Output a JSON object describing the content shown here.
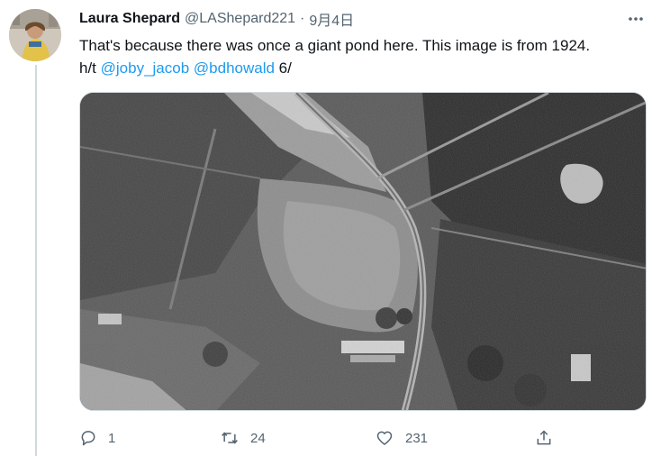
{
  "tweet": {
    "author": {
      "display_name": "Laura Shepard",
      "handle": "@LAShepard221",
      "separator": "·",
      "date": "9月4日",
      "avatar_icon": "avatar-photo"
    },
    "text": {
      "line1": "That's because there was once a giant pond here. This image is from 1924.",
      "prefix": "h/t ",
      "mention1": "@joby_jacob",
      "space": " ",
      "mention2": "@bdhowald",
      "suffix": " 6/"
    },
    "media": {
      "icon": "aerial-photo-1924"
    },
    "actions": {
      "reply": {
        "icon": "reply-icon",
        "count": "1"
      },
      "retweet": {
        "icon": "retweet-icon",
        "count": "24"
      },
      "like": {
        "icon": "heart-icon",
        "count": "231"
      },
      "share": {
        "icon": "share-icon"
      }
    },
    "menu": {
      "icon": "more-icon"
    }
  },
  "colors": {
    "text": "#0f1419",
    "secondary": "#536471",
    "link": "#1d9bf0",
    "border": "#cfd9de"
  }
}
